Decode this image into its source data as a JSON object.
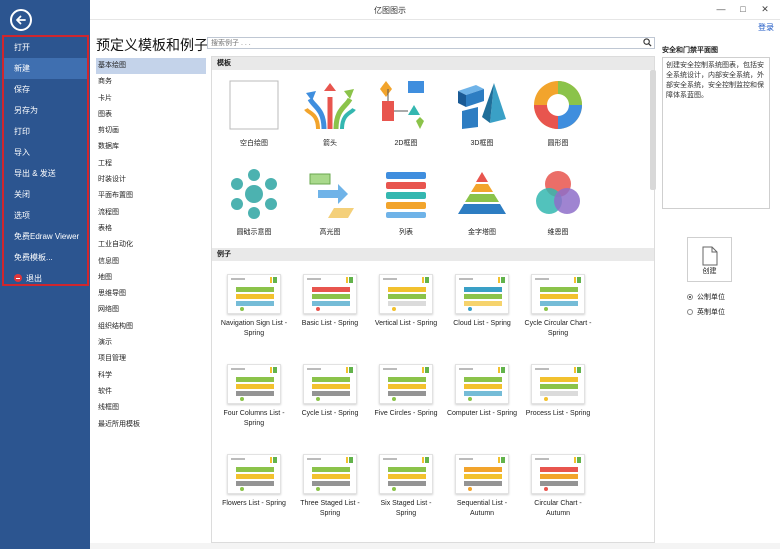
{
  "window": {
    "title": "亿图图示",
    "login": "登录",
    "min": "—",
    "max": "□",
    "close": "✕"
  },
  "sidebar": {
    "items": [
      {
        "label": "打开",
        "active": false
      },
      {
        "label": "新建",
        "active": true
      },
      {
        "label": "保存",
        "active": false
      },
      {
        "label": "另存为",
        "active": false
      },
      {
        "label": "打印",
        "active": false
      },
      {
        "label": "导入",
        "active": false
      },
      {
        "label": "导出 & 发送",
        "active": false
      },
      {
        "label": "关闭",
        "active": false
      },
      {
        "label": "选项",
        "active": false
      },
      {
        "label": "免费Edraw Viewer",
        "active": false
      },
      {
        "label": "免费模板...",
        "active": false
      },
      {
        "label": "退出",
        "active": false
      }
    ]
  },
  "header": {
    "title": "预定义模板和例子",
    "search_placeholder": "搜索例子 . . ."
  },
  "categories": [
    "基本绘图",
    "商务",
    "卡片",
    "图表",
    "剪切画",
    "数据库",
    "工程",
    "时装设计",
    "平面布置图",
    "流程图",
    "表格",
    "工业自动化",
    "信息图",
    "地图",
    "思维导图",
    "网络图",
    "组织结构图",
    "演示",
    "项目管理",
    "科学",
    "软件",
    "线框图",
    "最近所用模板"
  ],
  "main": {
    "templates_header": "模板",
    "templates": [
      {
        "label": "空白绘图",
        "icon": "blank-page-icon"
      },
      {
        "label": "箭头",
        "icon": "arrows-icon"
      },
      {
        "label": "2D框图",
        "icon": "2d-shapes-icon"
      },
      {
        "label": "3D框图",
        "icon": "3d-shapes-icon"
      },
      {
        "label": "圆形图",
        "icon": "circular-diagram-icon"
      },
      {
        "label": "圆础示意图",
        "icon": "hub-spoke-icon"
      },
      {
        "label": "高光图",
        "icon": "highlight-icon"
      },
      {
        "label": "列表",
        "icon": "list-icon"
      },
      {
        "label": "金字塔图",
        "icon": "pyramid-icon"
      },
      {
        "label": "维恩图",
        "icon": "venn-icon"
      }
    ],
    "examples_header": "例子",
    "examples": [
      {
        "label": "Navigation Sign List - Spring"
      },
      {
        "label": "Basic List - Spring"
      },
      {
        "label": "Vertical List - Spring"
      },
      {
        "label": "Cloud List - Spring"
      },
      {
        "label": "Cycle Circular Chart - Spring"
      },
      {
        "label": "Four Columns List - Spring"
      },
      {
        "label": "Cycle List - Spring"
      },
      {
        "label": "Five Circles - Spring"
      },
      {
        "label": "Computer List - Spring"
      },
      {
        "label": "Process List - Spring"
      },
      {
        "label": "Flowers List - Spring"
      },
      {
        "label": "Three Staged List - Spring"
      },
      {
        "label": "Six Staged List - Spring"
      },
      {
        "label": "Sequential List - Autumn"
      },
      {
        "label": "Circular Chart - Autumn"
      }
    ]
  },
  "right_panel": {
    "title": "安全和门禁平面图",
    "description": "创建安全控制系统图表，包括安全系统设计，内部安全系统，外部安全系统，安全控制监控和保障体系蓝图。",
    "create_label": "创建",
    "units": [
      {
        "label": "公制单位",
        "selected": true
      },
      {
        "label": "英制单位",
        "selected": false
      }
    ]
  },
  "colors": {
    "sidebar": "#2c5590",
    "sidebar_active": "#3f6fb0",
    "highlight_box": "#d0262d",
    "link": "#1a56c4"
  }
}
